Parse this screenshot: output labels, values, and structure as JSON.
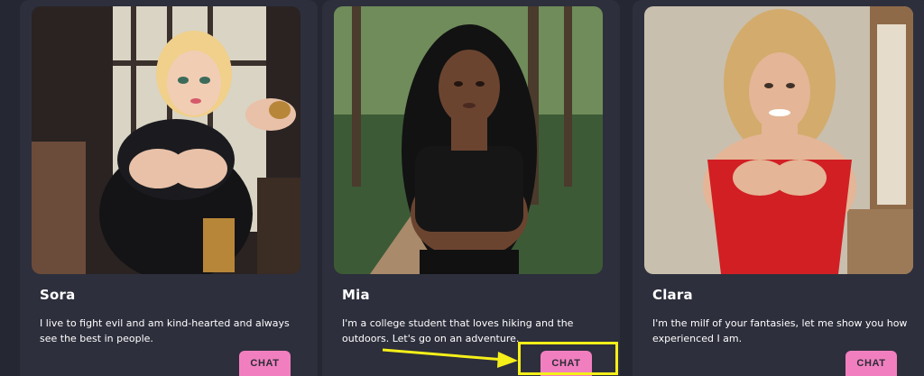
{
  "cards": [
    {
      "name": "Sora",
      "description": "I live to fight evil and am kind-hearted and always see the best in people.",
      "button_label": "CHAT",
      "photo_icon": "anime-character-portrait"
    },
    {
      "name": "Mia",
      "description": "I'm a college student that loves hiking and the outdoors. Let's go on an adventure.",
      "button_label": "CHAT",
      "photo_icon": "forest-trail-portrait"
    },
    {
      "name": "Clara",
      "description": "I'm the milf of your fantasies, let me show you how experienced I am.",
      "button_label": "CHAT",
      "photo_icon": "indoor-red-dress-portrait"
    }
  ],
  "annotation": {
    "color": "#f5ef1a"
  },
  "colors": {
    "background": "#252733",
    "card": "#2d2f3c",
    "button": "#f17fbf"
  }
}
